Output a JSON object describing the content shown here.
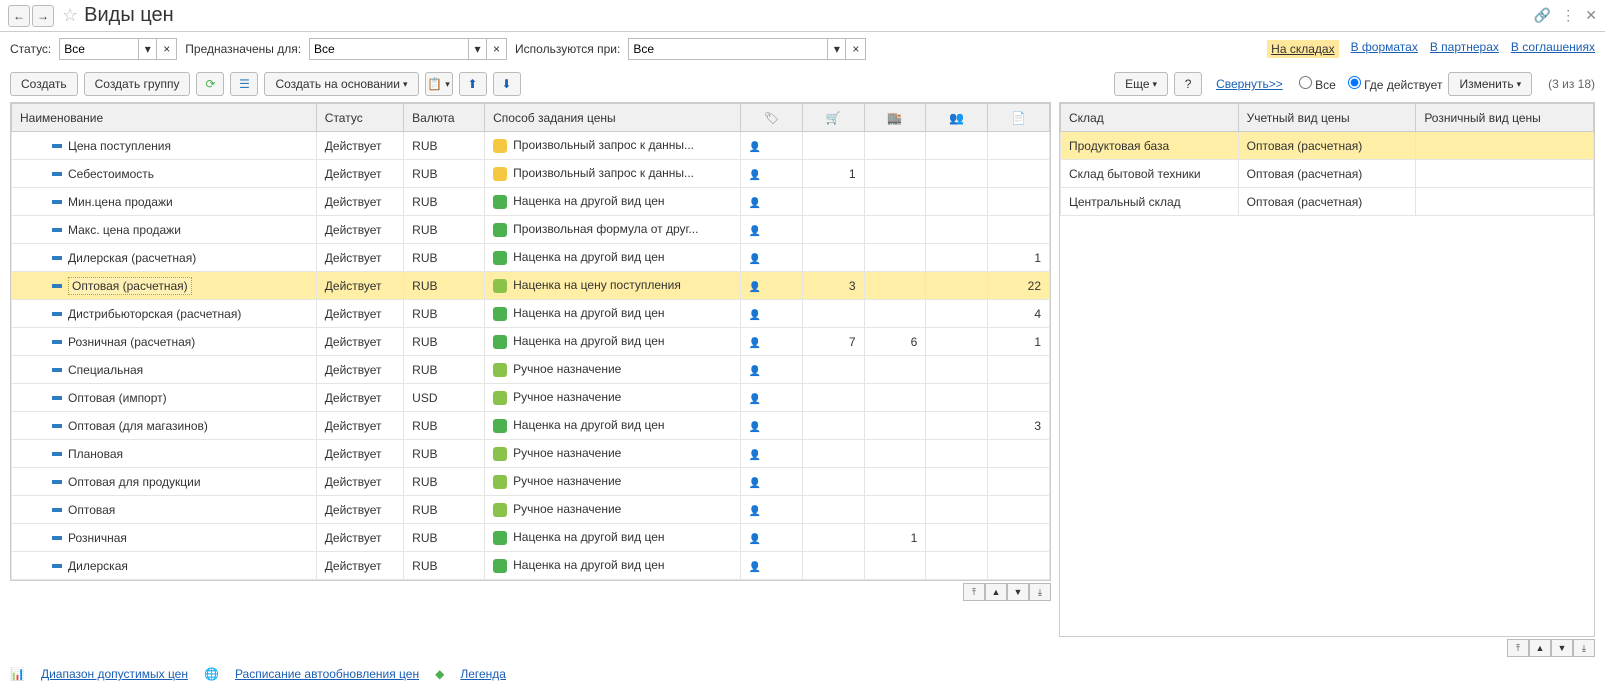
{
  "header": {
    "title": "Виды цен"
  },
  "filter_bar": {
    "status_label": "Статус:",
    "status_value": "Все",
    "purpose_label": "Предназначены для:",
    "purpose_value": "Все",
    "usage_label": "Используются при:",
    "usage_value": "Все",
    "links": {
      "in_warehouses": "На складах",
      "in_formats": "В форматах",
      "in_partners": "В партнерах",
      "in_agreements": "В соглашениях"
    }
  },
  "toolbar": {
    "create": "Создать",
    "create_group": "Создать группу",
    "create_based": "Создать на основании",
    "more": "Еще",
    "help": "?",
    "collapse": "Свернуть>>",
    "radio_all": "Все",
    "radio_active": "Где действует",
    "change": "Изменить",
    "page_count": "(3 из 18)"
  },
  "main_columns": {
    "name": "Наименование",
    "status": "Статус",
    "currency": "Валюта",
    "method": "Способ задания цены"
  },
  "main_rows": [
    {
      "name": "Цена поступления",
      "status": "Действует",
      "currency": "RUB",
      "method": "Произвольный запрос к данны...",
      "mi": "yellow",
      "c1": "",
      "c2": "",
      "c3": "",
      "c4": "",
      "c5": ""
    },
    {
      "name": "Себестоимость",
      "status": "Действует",
      "currency": "RUB",
      "method": "Произвольный запрос к данны...",
      "mi": "yellow",
      "c1": "",
      "c2": "1",
      "c3": "",
      "c4": "",
      "c5": ""
    },
    {
      "name": "Мин.цена продажи",
      "status": "Действует",
      "currency": "RUB",
      "method": "Наценка на другой вид цен",
      "mi": "green",
      "c1": "",
      "c2": "",
      "c3": "",
      "c4": "",
      "c5": ""
    },
    {
      "name": "Макс. цена продажи",
      "status": "Действует",
      "currency": "RUB",
      "method": "Произвольная формула от друг...",
      "mi": "green",
      "c1": "",
      "c2": "",
      "c3": "",
      "c4": "",
      "c5": ""
    },
    {
      "name": "Дилерская (расчетная)",
      "status": "Действует",
      "currency": "RUB",
      "method": "Наценка на другой вид цен",
      "mi": "green",
      "c1": "",
      "c2": "",
      "c3": "",
      "c4": "",
      "c5": "1"
    },
    {
      "name": "Оптовая (расчетная)",
      "status": "Действует",
      "currency": "RUB",
      "method": "Наценка на цену поступления",
      "mi": "green2",
      "c1": "",
      "c2": "3",
      "c3": "",
      "c4": "",
      "c5": "22",
      "selected": true
    },
    {
      "name": "Дистрибьюторская (расчетная)",
      "status": "Действует",
      "currency": "RUB",
      "method": "Наценка на другой вид цен",
      "mi": "green",
      "c1": "",
      "c2": "",
      "c3": "",
      "c4": "",
      "c5": "4"
    },
    {
      "name": "Розничная (расчетная)",
      "status": "Действует",
      "currency": "RUB",
      "method": "Наценка на другой вид цен",
      "mi": "green",
      "c1": "",
      "c2": "7",
      "c3": "6",
      "c4": "",
      "c5": "1"
    },
    {
      "name": "Специальная",
      "status": "Действует",
      "currency": "RUB",
      "method": "Ручное назначение",
      "mi": "green2",
      "c1": "",
      "c2": "",
      "c3": "",
      "c4": "",
      "c5": ""
    },
    {
      "name": "Оптовая (импорт)",
      "status": "Действует",
      "currency": "USD",
      "method": "Ручное назначение",
      "mi": "green2",
      "c1": "",
      "c2": "",
      "c3": "",
      "c4": "",
      "c5": ""
    },
    {
      "name": "Оптовая (для магазинов)",
      "status": "Действует",
      "currency": "RUB",
      "method": "Наценка на другой вид цен",
      "mi": "green",
      "c1": "",
      "c2": "",
      "c3": "",
      "c4": "",
      "c5": "3"
    },
    {
      "name": "Плановая",
      "status": "Действует",
      "currency": "RUB",
      "method": "Ручное назначение",
      "mi": "green2",
      "c1": "",
      "c2": "",
      "c3": "",
      "c4": "",
      "c5": ""
    },
    {
      "name": "Оптовая для продукции",
      "status": "Действует",
      "currency": "RUB",
      "method": "Ручное назначение",
      "mi": "green2",
      "c1": "",
      "c2": "",
      "c3": "",
      "c4": "",
      "c5": ""
    },
    {
      "name": "Оптовая",
      "status": "Действует",
      "currency": "RUB",
      "method": "Ручное назначение",
      "mi": "green2",
      "c1": "",
      "c2": "",
      "c3": "",
      "c4": "",
      "c5": ""
    },
    {
      "name": "Розничная",
      "status": "Действует",
      "currency": "RUB",
      "method": "Наценка на другой вид цен",
      "mi": "green",
      "c1": "",
      "c2": "",
      "c3": "1",
      "c4": "",
      "c5": ""
    },
    {
      "name": "Дилерская",
      "status": "Действует",
      "currency": "RUB",
      "method": "Наценка на другой вид цен",
      "mi": "green",
      "c1": "",
      "c2": "",
      "c3": "",
      "c4": "",
      "c5": ""
    }
  ],
  "right_columns": {
    "warehouse": "Склад",
    "account_type": "Учетный вид цены",
    "retail_type": "Розничный вид цены"
  },
  "right_rows": [
    {
      "warehouse": "Продуктовая база",
      "account": "Оптовая (расчетная)",
      "retail": "",
      "selected": true
    },
    {
      "warehouse": "Склад бытовой техники",
      "account": "Оптовая (расчетная)",
      "retail": ""
    },
    {
      "warehouse": "Центральный склад",
      "account": "Оптовая (расчетная)",
      "retail": ""
    }
  ],
  "footer": {
    "range": "Диапазон допустимых цен",
    "schedule": "Расписание автообновления цен",
    "legend": "Легенда"
  }
}
